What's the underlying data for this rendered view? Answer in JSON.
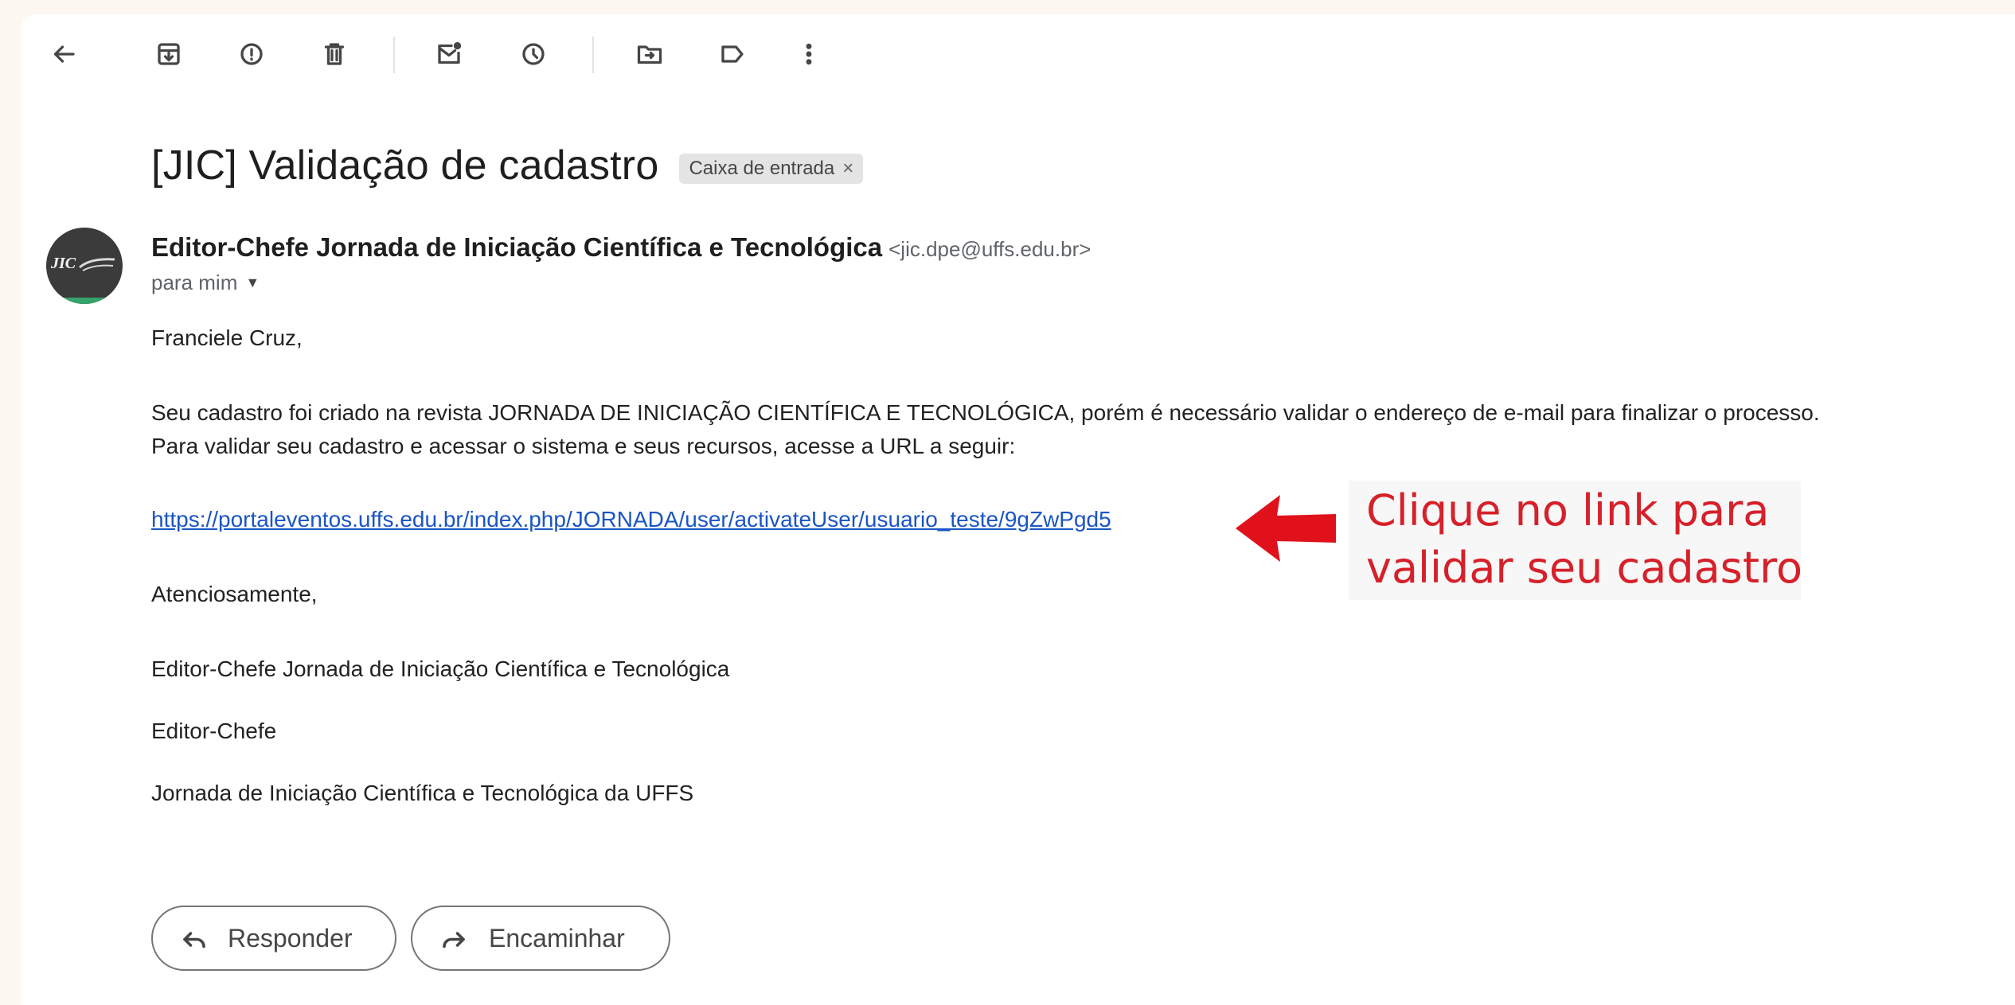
{
  "toolbar": {
    "icons": [
      "back-arrow-icon",
      "archive-icon",
      "report-spam-icon",
      "delete-icon",
      "mark-unread-icon",
      "snooze-icon",
      "move-to-icon",
      "label-icon",
      "more-vert-icon"
    ]
  },
  "message": {
    "subject": "[JIC] Validação de cadastro",
    "label": "Caixa de entrada",
    "label_close": "×",
    "sender_name": "Editor-Chefe Jornada de Iniciação Científica e Tecnológica",
    "sender_email": "<jic.dpe@uffs.edu.br>",
    "recipient": "para mim",
    "avatar_text": "JIC"
  },
  "body": {
    "greeting": "Franciele Cruz,",
    "line1": "Seu cadastro foi criado na revista JORNADA DE INICIAÇÃO CIENTÍFICA E TECNOLÓGICA, porém é necessário validar o endereço de e-mail para finalizar o processo.",
    "line2": "Para validar seu cadastro e acessar o sistema e seus recursos, acesse a URL a seguir:",
    "link": "https://portaleventos.uffs.edu.br/index.php/JORNADA/user/activateUser/usuario_teste/9gZwPgd5",
    "closing": "Atenciosamente,",
    "signature1": "Editor-Chefe Jornada de Iniciação Científica e Tecnológica",
    "signature2": "Editor-Chefe",
    "signature3": "Jornada de Iniciação Científica e Tecnológica da UFFS"
  },
  "annotation": {
    "line1": "Clique no link para",
    "line2": "validar seu cadastro",
    "color": "#d6202a"
  },
  "actions": {
    "reply": "Responder",
    "forward": "Encaminhar"
  }
}
